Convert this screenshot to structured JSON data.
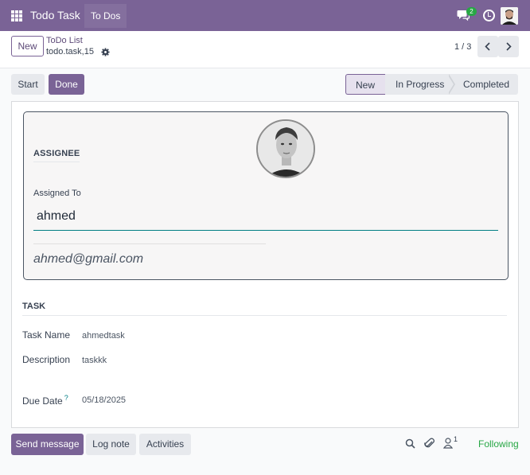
{
  "navbar": {
    "app_name": "Todo Task",
    "menu_label": "To Dos",
    "messages_count": "2",
    "bg_color": "#7a6396"
  },
  "control_panel": {
    "new_label": "New",
    "breadcrumb_parent": "ToDo List",
    "record_name": "todo.task,15",
    "pager_value": "1 / 3"
  },
  "statusbar": {
    "buttons": [
      "Start",
      "Done"
    ],
    "stages": [
      "New",
      "In Progress",
      "Completed"
    ],
    "active_stage": "New"
  },
  "assignee": {
    "section_title": "ASSIGNEE",
    "assigned_label": "Assigned To",
    "assigned_value": "ahmed",
    "email": "ahmed@gmail.com"
  },
  "task": {
    "section_title": "TASK",
    "fields": [
      {
        "label": "Task Name",
        "value": "ahmedtask"
      },
      {
        "label": "Description",
        "value": "taskkk"
      },
      {
        "label": "Due Date",
        "help": "?",
        "value": "05/18/2025"
      }
    ]
  },
  "chatter": {
    "send_message": "Send message",
    "log_note": "Log note",
    "activities": "Activities",
    "followers_count": "1",
    "following": "Following"
  },
  "colors": {
    "primary": "#7a6396",
    "accent_teal": "#017e84",
    "success": "#28a745"
  }
}
